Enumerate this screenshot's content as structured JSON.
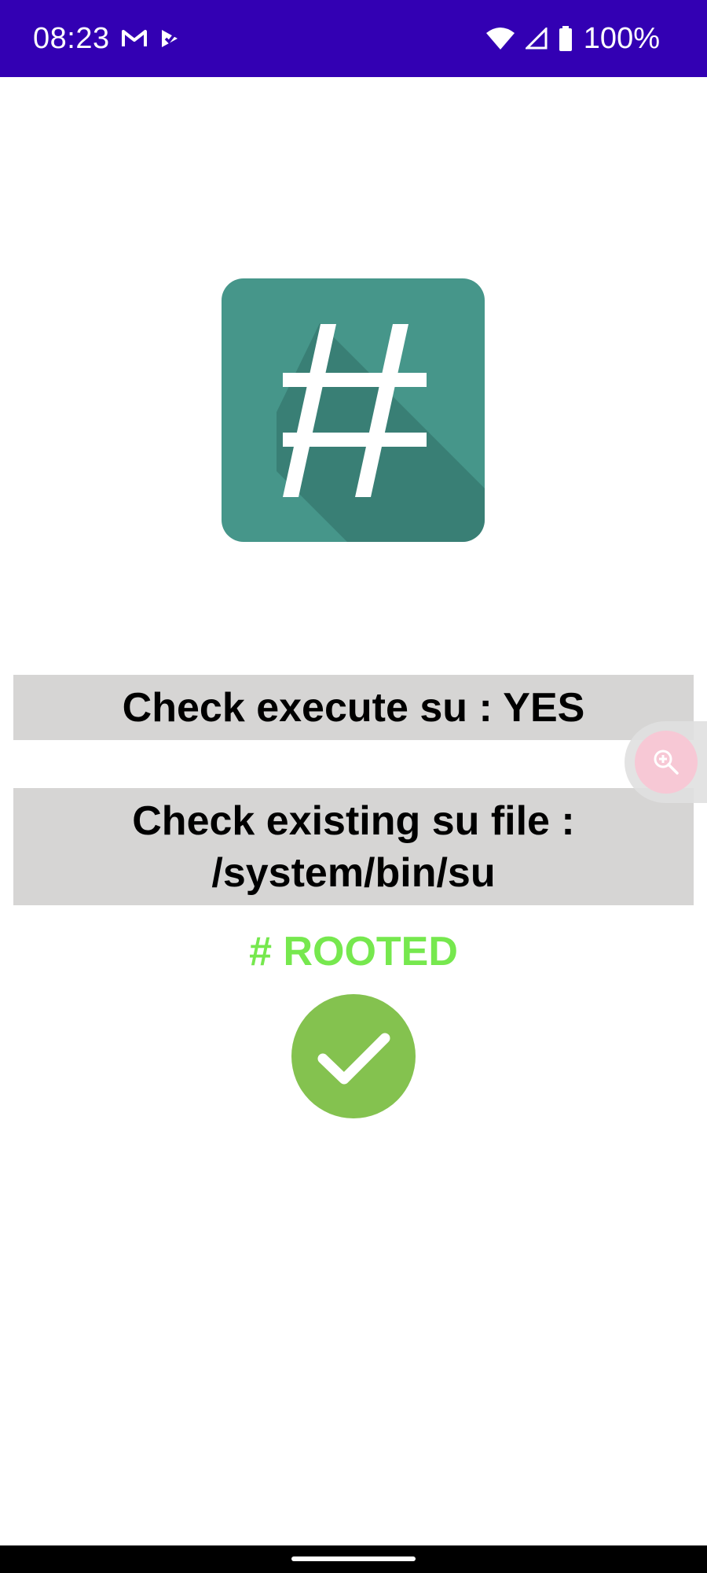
{
  "status_bar": {
    "time": "08:23",
    "battery": "100%",
    "left_icons": [
      "gmail-icon",
      "task-check-icon"
    ],
    "right_icons": [
      "wifi-icon",
      "signal-icon",
      "battery-icon"
    ],
    "background": "#3300b3"
  },
  "app": {
    "logo_icon": "hash-icon",
    "logo_color": "#46968a",
    "check_su_text": "Check execute su : YES",
    "check_file_text": "Check existing su file : /system/bin/su",
    "rooted_text": "# ROOTED",
    "rooted_color": "#76e84e",
    "success_icon": "checkmark-icon",
    "success_color": "#84c24f"
  },
  "overlay": {
    "zoom_icon": "zoom-in-icon"
  }
}
